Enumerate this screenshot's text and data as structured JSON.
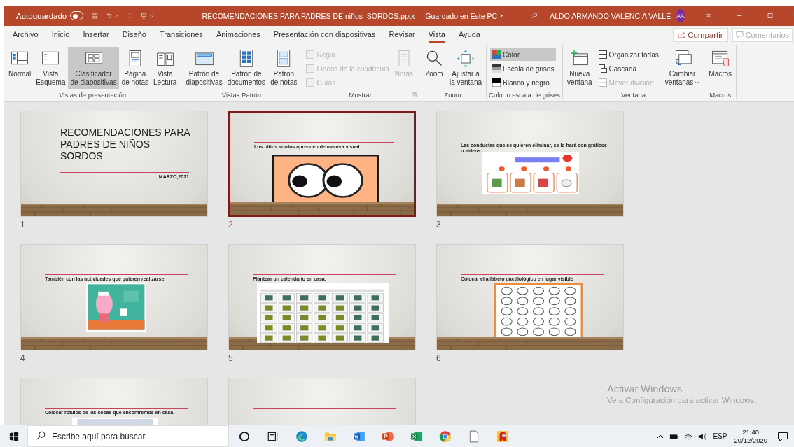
{
  "title_bar": {
    "autosave_label": "Autoguardado",
    "autosave_on": false,
    "document_title": "RECOMENDACIONES PARA PADRES DE niños  SORDOS.pptx  -  Guardado en Este PC",
    "user_name": "ALDO ARMANDO VALENCIA VALLE",
    "user_initials": "AA"
  },
  "menu_tabs": [
    {
      "label": "Archivo",
      "selected": false
    },
    {
      "label": "Inicio",
      "selected": false
    },
    {
      "label": "Insertar",
      "selected": false
    },
    {
      "label": "Diseño",
      "selected": false
    },
    {
      "label": "Transiciones",
      "selected": false
    },
    {
      "label": "Animaciones",
      "selected": false
    },
    {
      "label": "Presentación con diapositivas",
      "selected": false
    },
    {
      "label": "Revisar",
      "selected": false
    },
    {
      "label": "Vista",
      "selected": true
    },
    {
      "label": "Ayuda",
      "selected": false
    }
  ],
  "share_button": "Compartir",
  "comments_button": "Comentarios",
  "ribbon_groups": [
    {
      "label": "Vistas de presentación",
      "columns": [
        {
          "kind": "large",
          "label": "Normal",
          "selected": false,
          "disabled": false
        },
        {
          "kind": "large",
          "label": "Vista\nEsquema",
          "selected": false,
          "disabled": false
        },
        {
          "kind": "large",
          "label": "Clasificador\nde diapositivas",
          "selected": true,
          "disabled": false
        },
        {
          "kind": "large",
          "label": "Página\nde notas",
          "selected": false,
          "disabled": false
        },
        {
          "kind": "large",
          "label": "Vista\nLectura",
          "selected": false,
          "disabled": false
        }
      ]
    },
    {
      "label": "Vistas Patrón",
      "columns": [
        {
          "kind": "large",
          "label": "Patrón de\ndiapositivas",
          "selected": false,
          "disabled": false
        },
        {
          "kind": "large",
          "label": "Patrón de\ndocumentos",
          "selected": false,
          "disabled": false
        },
        {
          "kind": "large",
          "label": "Patrón\nde notas",
          "selected": false,
          "disabled": false
        }
      ]
    },
    {
      "label": "Mostrar",
      "launcher": true,
      "columns": [
        {
          "kind": "stack",
          "items": [
            {
              "kind": "check",
              "label": "Regla",
              "checked": false,
              "disabled": true
            },
            {
              "kind": "check",
              "label": "Líneas de la cuadrícula",
              "checked": false,
              "disabled": true
            },
            {
              "kind": "check",
              "label": "Guías",
              "checked": false,
              "disabled": true
            }
          ]
        },
        {
          "kind": "large",
          "label": "Notas",
          "selected": false,
          "disabled": true
        }
      ]
    },
    {
      "label": "Zoom",
      "columns": [
        {
          "kind": "large",
          "label": "Zoom",
          "selected": false,
          "disabled": false
        },
        {
          "kind": "large",
          "label": "Ajustar a\nla ventana",
          "selected": false,
          "disabled": false
        }
      ]
    },
    {
      "label": "Color o escala de grises",
      "columns": [
        {
          "kind": "stack",
          "items": [
            {
              "kind": "small",
              "label": "Color",
              "selected": true,
              "disabled": false
            },
            {
              "kind": "small",
              "label": "Escala de grises",
              "selected": false,
              "disabled": false
            },
            {
              "kind": "small",
              "label": "Blanco y negro",
              "selected": false,
              "disabled": false
            }
          ]
        }
      ]
    },
    {
      "label": "Ventana",
      "columns": [
        {
          "kind": "large",
          "label": "Nueva\nventana",
          "selected": false,
          "disabled": false
        },
        {
          "kind": "stack",
          "items": [
            {
              "kind": "small",
              "label": "Organizar todas",
              "selected": false,
              "disabled": false
            },
            {
              "kind": "small",
              "label": "Cascada",
              "selected": false,
              "disabled": false
            },
            {
              "kind": "small",
              "label": "Mover división",
              "selected": false,
              "disabled": true
            }
          ]
        },
        {
          "kind": "large",
          "label": "Cambiar\nventanas",
          "selected": false,
          "disabled": false,
          "menu": true
        }
      ]
    },
    {
      "label": "Macros",
      "columns": [
        {
          "kind": "large",
          "label": "Macros",
          "selected": false,
          "disabled": false
        }
      ]
    }
  ],
  "slides": [
    {
      "number": "1",
      "selected": false,
      "title": "RECOMENDACIONES PARA PADRES DE NIÑOS SORDOS",
      "subtitle": "MARZO,2021"
    },
    {
      "number": "2",
      "selected": true,
      "bullet": "Los niños sordos aprenden de manera visual."
    },
    {
      "number": "3",
      "selected": false,
      "bullet": "Las conductas que se quieren eliminar, se lo hará con gráficos o videos."
    },
    {
      "number": "4",
      "selected": false,
      "bullet": "También con las actividades que quieren realizarse."
    },
    {
      "number": "5",
      "selected": false,
      "bullet": "Plantear un calendario en casa."
    },
    {
      "number": "6",
      "selected": false,
      "bullet": "Colocar el alfabeto dactilológico en lugar visible"
    },
    {
      "selected": false,
      "bullet": "Colocar rótulos de las cosas que encontremos en casa."
    },
    {
      "selected": false
    }
  ],
  "activation_notice": {
    "title": "Activar Windows",
    "text": "Ve a Configuración para activar Windows."
  },
  "taskbar": {
    "search_placeholder": "Escribe aquí para buscar",
    "language": "ESP",
    "time": "21:40",
    "date": "20/12/2020"
  }
}
